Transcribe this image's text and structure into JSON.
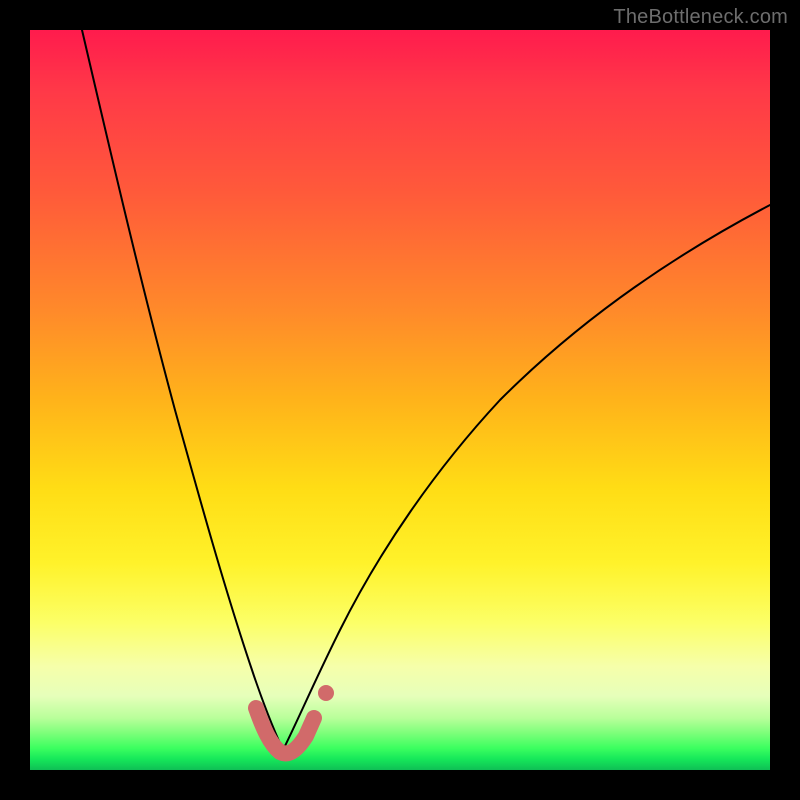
{
  "watermark": "TheBottleneck.com",
  "colors": {
    "frame": "#000000",
    "curve": "#000000",
    "highlight": "#d16a6a",
    "gradient_top": "#ff1b4d",
    "gradient_bottom": "#0fbf55"
  },
  "chart_data": {
    "type": "line",
    "title": "",
    "xlabel": "",
    "ylabel": "",
    "xlim": [
      0,
      100
    ],
    "ylim": [
      0,
      100
    ],
    "grid": false,
    "legend": false,
    "description": "Two-branch bottleneck curve (V-shape). Left branch descends steeply from top-left to trough; right branch rises more gently toward top-right. Values are read from pixel geometry as percent of axis span; trough ≈ 0% bottleneck near x ≈ 34.",
    "series": [
      {
        "name": "left-branch",
        "x": [
          7,
          10,
          13,
          16,
          19,
          22,
          25,
          27,
          29,
          30.5,
          32,
          33,
          34
        ],
        "y": [
          100,
          92,
          82,
          71,
          60,
          48,
          36,
          26,
          17,
          10,
          5,
          2,
          0
        ]
      },
      {
        "name": "right-branch",
        "x": [
          34,
          36,
          38,
          40,
          43,
          47,
          52,
          58,
          65,
          73,
          82,
          91,
          100
        ],
        "y": [
          0,
          3,
          7,
          12,
          19,
          28,
          38,
          47,
          55,
          62,
          68,
          73,
          77
        ]
      }
    ],
    "highlight_region": {
      "note": "Thick reddish segment at trough ('good' zone near zero bottleneck)",
      "x": [
        30.5,
        32,
        33,
        34,
        35,
        36,
        37,
        38
      ],
      "y": [
        8.5,
        5,
        2,
        0.5,
        0.5,
        2,
        4.5,
        8
      ],
      "lone_dot": {
        "x": 39.5,
        "y": 12
      }
    }
  }
}
